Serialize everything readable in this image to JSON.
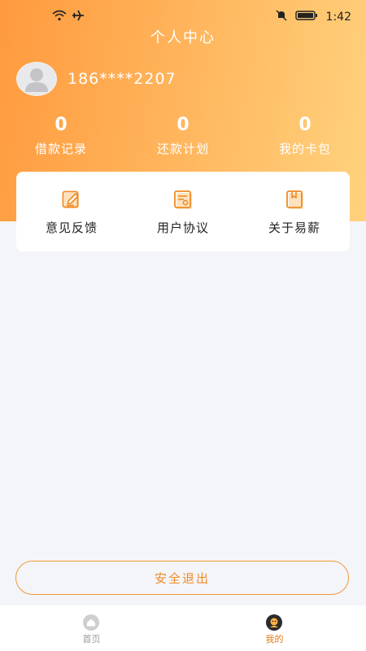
{
  "status_bar": {
    "time": "1:42"
  },
  "header": {
    "title": "个人中心"
  },
  "user": {
    "phone": "186****2207"
  },
  "stats": [
    {
      "value": "0",
      "label": "借款记录"
    },
    {
      "value": "0",
      "label": "还款计划"
    },
    {
      "value": "0",
      "label": "我的卡包"
    }
  ],
  "menu": [
    {
      "label": "意见反馈",
      "icon": "edit-icon"
    },
    {
      "label": "用户协议",
      "icon": "document-icon"
    },
    {
      "label": "关于易薪",
      "icon": "book-icon"
    }
  ],
  "logout_label": "安全退出",
  "tabs": [
    {
      "label": "首页",
      "icon": "home-icon",
      "active": false
    },
    {
      "label": "我的",
      "icon": "profile-icon",
      "active": true
    }
  ],
  "colors": {
    "accent": "#f08a24",
    "header_start": "#ff9a3e",
    "header_end": "#ffd27e",
    "tab_active": "#e07a1a",
    "tab_inactive": "#9a9a9a"
  }
}
